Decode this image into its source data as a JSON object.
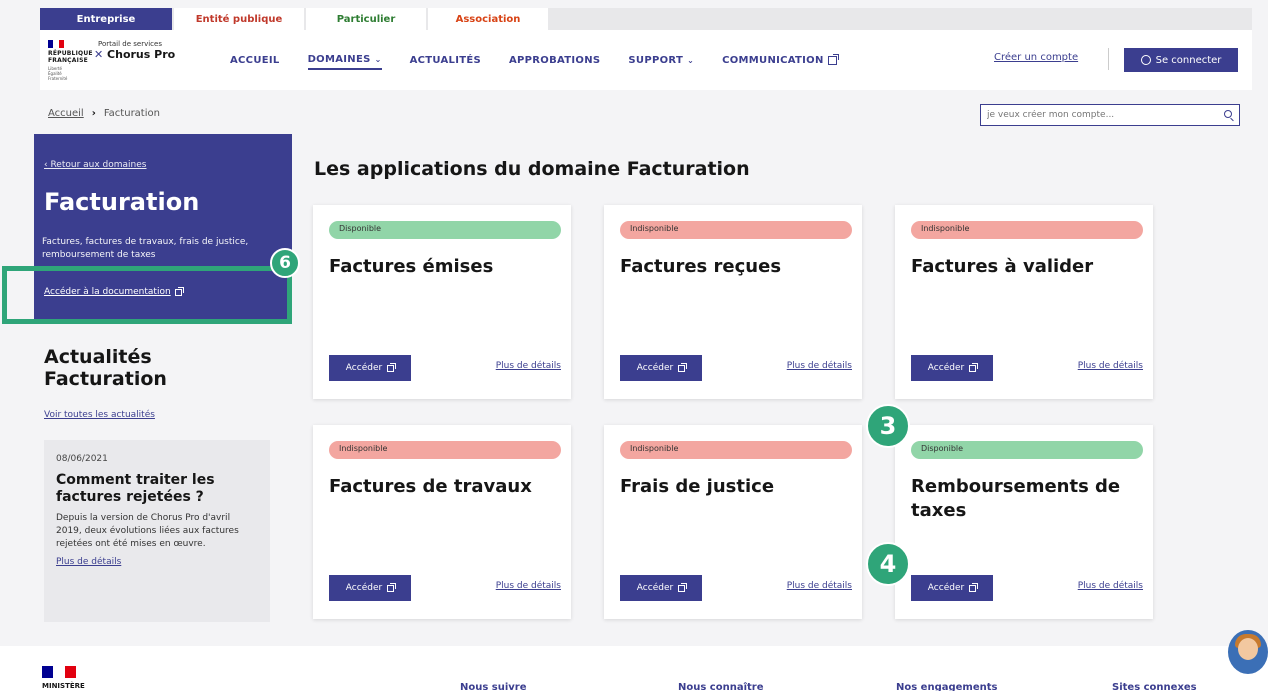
{
  "audience_tabs": [
    "Entreprise",
    "Entité publique",
    "Particulier",
    "Association"
  ],
  "header": {
    "logo_line1": "RÉPUBLIQUE",
    "logo_line2": "FRANÇAISE",
    "logo_motto": "Liberté Égalité Fraternité",
    "portal_subtitle": "Portail de services",
    "portal_name": "Chorus Pro",
    "nav": [
      "ACCUEIL",
      "DOMAINES",
      "ACTUALITÉS",
      "APPROBATIONS",
      "SUPPORT",
      "COMMUNICATION"
    ],
    "create_account": "Créer un compte",
    "connect": "Se connecter"
  },
  "breadcrumb": {
    "home": "Accueil",
    "separator": "›",
    "current": "Facturation"
  },
  "search": {
    "placeholder": "je veux créer mon compte..."
  },
  "sidebar": {
    "back_link": "‹ Retour aux domaines",
    "title": "Facturation",
    "description": "Factures, factures de travaux, frais de justice, remboursement de taxes",
    "doc_link": "Accéder à la documentation",
    "news_title": "Actualités Facturation",
    "all_news": "Voir toutes les actualités",
    "news": {
      "date": "08/06/2021",
      "headline": "Comment traiter les factures rejetées ?",
      "body": "Depuis la version de Chorus Pro d'avril 2019, deux évolutions liées aux factures rejetées ont été mises en œuvre.",
      "more": "Plus de détails"
    }
  },
  "main": {
    "title": "Les applications du domaine Facturation",
    "access_label": "Accéder",
    "details_label": "Plus de détails",
    "cards": [
      {
        "status": "Disponible",
        "title": "Factures émises"
      },
      {
        "status": "Indisponible",
        "title": "Factures reçues"
      },
      {
        "status": "Indisponible",
        "title": "Factures à valider"
      },
      {
        "status": "Indisponible",
        "title": "Factures de travaux"
      },
      {
        "status": "Indisponible",
        "title": "Frais de justice"
      },
      {
        "status": "Disponible",
        "title": "Remboursements de taxes"
      }
    ]
  },
  "callouts": [
    "6",
    "3",
    "4"
  ],
  "footer": {
    "ministry": "MINISTÈRE",
    "links": [
      "Nous suivre",
      "Nous connaître",
      "Nos engagements",
      "Sites connexes"
    ]
  },
  "colors": {
    "primary": "#3b3e8f",
    "callout": "#2fa579",
    "available": "#91d5a8",
    "unavailable": "#f3a6a0"
  }
}
